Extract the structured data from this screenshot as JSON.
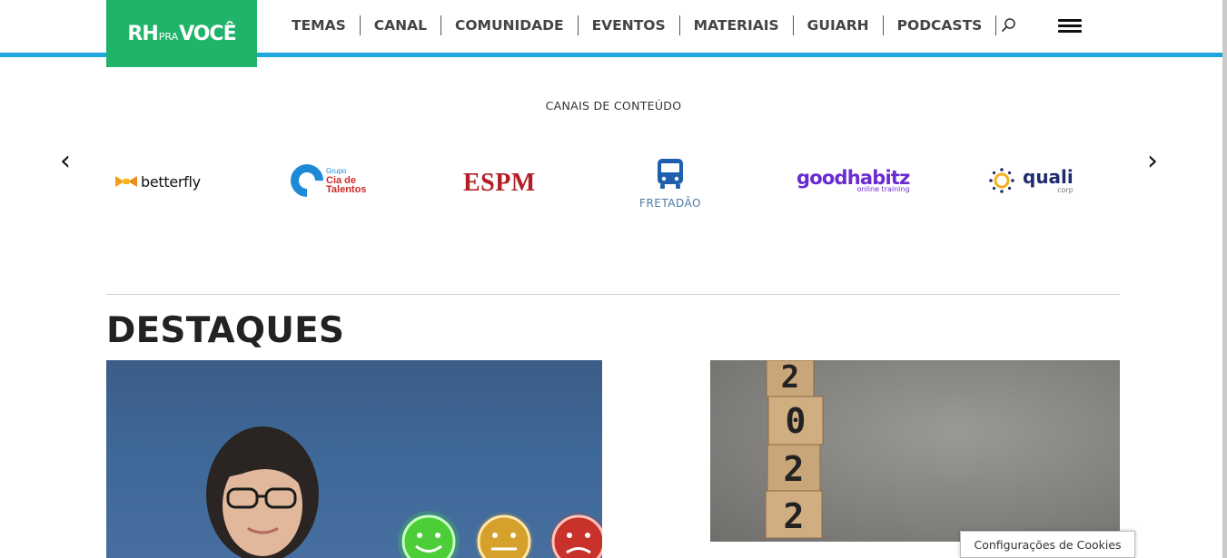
{
  "logo": {
    "part1": "RH",
    "part2": "PRA",
    "part3": "VOCÊ"
  },
  "nav": {
    "items": [
      "TEMAS",
      "CANAL",
      "COMUNIDADE",
      "EVENTOS",
      "MATERIAIS",
      "GUIARH",
      "PODCASTS"
    ]
  },
  "icons": {
    "search": "search-icon",
    "menu": "hamburger-menu-icon",
    "prev": "chevron-left-icon",
    "next": "chevron-right-icon"
  },
  "channels": {
    "title": "CANAIS DE CONTEÚDO",
    "prev_arrow": "‹",
    "next_arrow": "›",
    "partners": {
      "betterfly": "betterfly",
      "cia_group": "Grupo",
      "cia_name": "Cia de",
      "cia_sub": "Talentos",
      "espm": "ESPM",
      "fretadao": "FRETADÃO",
      "goodhabitz": "goodhabitz",
      "goodhabitz_sub": "online training",
      "quali": "quali",
      "quali_sub": "corp"
    }
  },
  "highlights": {
    "title": "DESTAQUES"
  },
  "cookies": {
    "label": "Configurações de Cookies"
  },
  "colors": {
    "brand_green": "#20b46a",
    "accent_blue": "#1ea7dc"
  }
}
